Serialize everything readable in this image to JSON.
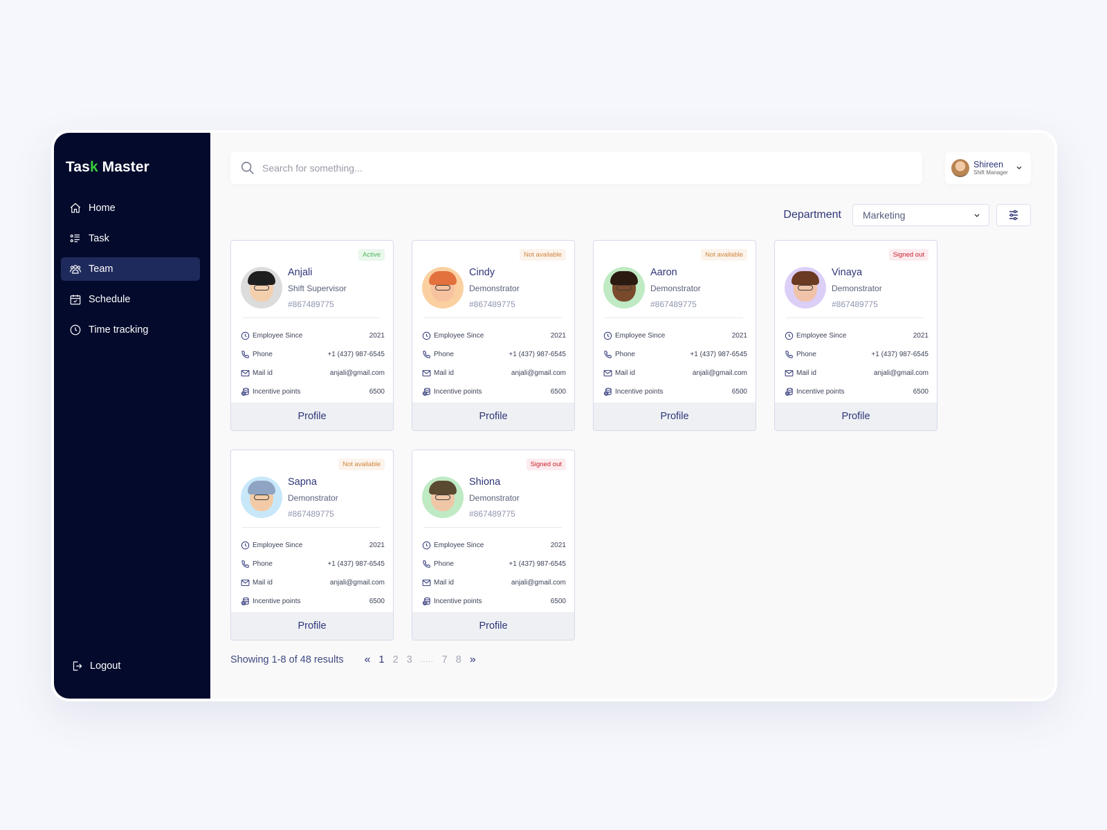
{
  "app": {
    "logo_prefix": "Tas",
    "logo_tick": "k",
    "logo_suffix": " Master"
  },
  "sidebar": {
    "items": [
      {
        "label": "Home",
        "icon": "home-icon",
        "active": false
      },
      {
        "label": "Task",
        "icon": "task-list-icon",
        "active": false
      },
      {
        "label": "Team",
        "icon": "team-icon",
        "active": true
      },
      {
        "label": "Schedule",
        "icon": "calendar-icon",
        "active": false
      },
      {
        "label": "Time tracking",
        "icon": "clock-icon",
        "active": false
      }
    ],
    "logout_label": "Logout"
  },
  "header": {
    "search_placeholder": "Search for something...",
    "user": {
      "name": "Shireen",
      "role": "Shift Manager"
    }
  },
  "filter": {
    "department_label": "Department",
    "department_value": "Marketing"
  },
  "labels": {
    "employee_since": "Employee Since",
    "phone": "Phone",
    "mail": "Mail id",
    "incentive": "Incentive points",
    "profile_button": "Profile"
  },
  "colors": {
    "sidebar_bg": "#030a2c",
    "active_nav_bg": "#1f2a5c",
    "accent_text": "#2e3577",
    "logo_tick": "#3ccc3c",
    "status_active": "#4cb85c",
    "status_not_available": "#d0853d",
    "status_signed_out": "#c9232d"
  },
  "employees": [
    {
      "name": "Anjali",
      "role": "Shift Supervisor",
      "id": "#867489775",
      "status": "Active",
      "status_type": "active",
      "since": "2021",
      "phone": "+1 (437) 987-6545",
      "mail": "anjali@gmail.com",
      "incentive": "6500",
      "avatar_bg": "#dcdcdc",
      "skin": "#f4cfae",
      "hair": "#1e1e1e"
    },
    {
      "name": "Cindy",
      "role": "Demonstrator",
      "id": "#867489775",
      "status": "Not available",
      "status_type": "na",
      "since": "2021",
      "phone": "+1 (437) 987-6545",
      "mail": "anjali@gmail.com",
      "incentive": "6500",
      "avatar_bg": "#fbd0a0",
      "skin": "#f7c2a0",
      "hair": "#e2713e"
    },
    {
      "name": "Aaron",
      "role": "Demonstrator",
      "id": "#867489775",
      "status": "Not available",
      "status_type": "na",
      "since": "2021",
      "phone": "+1 (437) 987-6545",
      "mail": "anjali@gmail.com",
      "incentive": "6500",
      "avatar_bg": "#bfeac4",
      "skin": "#7a4a2c",
      "hair": "#2b1a10"
    },
    {
      "name": "Vinaya",
      "role": "Demonstrator",
      "id": "#867489775",
      "status": "Signed out",
      "status_type": "so",
      "since": "2021",
      "phone": "+1 (437) 987-6545",
      "mail": "anjali@gmail.com",
      "incentive": "6500",
      "avatar_bg": "#dccff7",
      "skin": "#f0c3a8",
      "hair": "#6b3a23"
    },
    {
      "name": "Sapna",
      "role": "Demonstrator",
      "id": "#867489775",
      "status": "Not available",
      "status_type": "na",
      "since": "2021",
      "phone": "+1 (437) 987-6545",
      "mail": "anjali@gmail.com",
      "incentive": "6500",
      "avatar_bg": "#c8e8fa",
      "skin": "#f2cba6",
      "hair": "#8fa3c2"
    },
    {
      "name": "Shiona",
      "role": "Demonstrator",
      "id": "#867489775",
      "status": "Signed out",
      "status_type": "so",
      "since": "2021",
      "phone": "+1 (437) 987-6545",
      "mail": "anjali@gmail.com",
      "incentive": "6500",
      "avatar_bg": "#bfeac4",
      "skin": "#f0c7a6",
      "hair": "#5a4a32"
    }
  ],
  "pagination": {
    "summary": "Showing 1-8 of 48 results",
    "prev": "«",
    "next": "»",
    "pages": [
      "1",
      "2",
      "3",
      ".....",
      "7",
      "8"
    ],
    "current": "1"
  }
}
